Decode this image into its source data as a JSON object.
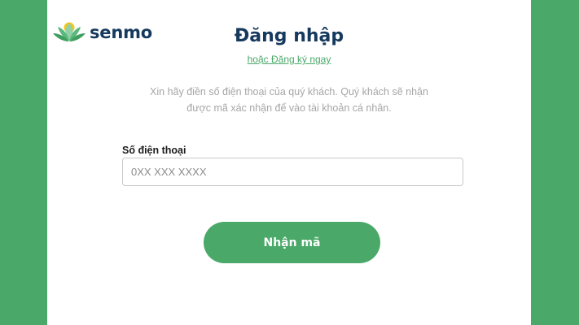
{
  "brand": {
    "name": "senmo",
    "primary_color": "#4aa868",
    "text_color": "#16395e",
    "logo_icon": "lotus-icon"
  },
  "header": {
    "title": "Đăng nhập",
    "signup_link": "hoặc Đăng ký ngay"
  },
  "description": {
    "line1": "Xin hãy điền số điện thoại của quý khách. Quý khách sẽ nhận",
    "line2": "được mã xác nhận để vào tài khoản cá nhân."
  },
  "form": {
    "phone_label": "Số điện thoại",
    "phone_placeholder": "0XX XXX XXXX",
    "phone_value": "",
    "submit_label": "Nhận mã"
  }
}
